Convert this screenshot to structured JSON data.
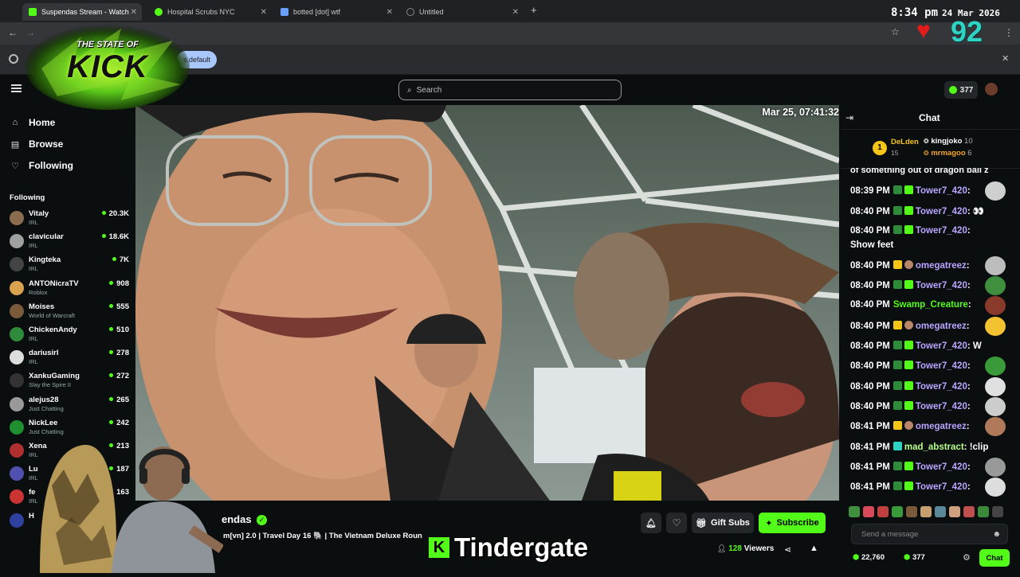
{
  "browser": {
    "tabs": [
      {
        "label": "Suspendas Stream - Watch",
        "active": true,
        "color": "#53fc18"
      },
      {
        "label": "Hospital Scrubs NYC",
        "active": false,
        "color": "#53fc18"
      },
      {
        "label": "botted [dot] wtf",
        "active": false,
        "color": "#6aa0ff"
      },
      {
        "label": "Untitled",
        "active": false,
        "color": "#888888"
      }
    ],
    "info_text": "s.default"
  },
  "overlay": {
    "clock": "8:34 pm",
    "date": "24 Mar 2026",
    "heart_count": "92",
    "logo_line1": "THE STATE OF",
    "logo_line2": "KICK",
    "bottom_banner": "Tindergate"
  },
  "header": {
    "search_placeholder": "Search",
    "points": "377"
  },
  "sidebar": {
    "nav": [
      {
        "label": "Home",
        "icon": "home-icon"
      },
      {
        "label": "Browse",
        "icon": "browse-icon"
      },
      {
        "label": "Following",
        "icon": "heart-icon"
      }
    ],
    "following_title": "Following",
    "following": [
      {
        "name": "Vitaly",
        "category": "IRL",
        "viewers": "20.3K",
        "color": "#8a6d4e"
      },
      {
        "name": "clavicular",
        "category": "IRL",
        "viewers": "18.6K",
        "color": "#a0a0a0"
      },
      {
        "name": "Kingteka",
        "category": "IRL",
        "viewers": "7K",
        "color": "#444444"
      },
      {
        "name": "ANTONicraTV",
        "category": "Roblox",
        "viewers": "908",
        "color": "#d9a24e"
      },
      {
        "name": "Moises",
        "category": "World of Warcraft",
        "viewers": "555",
        "color": "#7a5a3a"
      },
      {
        "name": "ChickenAndy",
        "category": "IRL",
        "viewers": "510",
        "color": "#2e8b3a"
      },
      {
        "name": "dariusirl",
        "category": "IRL",
        "viewers": "278",
        "color": "#dddddd"
      },
      {
        "name": "XankuGaming",
        "category": "Slay the Spire II",
        "viewers": "272",
        "color": "#333333"
      },
      {
        "name": "alejus28",
        "category": "Just Chatting",
        "viewers": "265",
        "color": "#999999"
      },
      {
        "name": "NickLee",
        "category": "Just Chatting",
        "viewers": "242",
        "color": "#1f8f2f"
      },
      {
        "name": "Xena",
        "category": "IRL",
        "viewers": "213",
        "color": "#b03030"
      },
      {
        "name": "Lu",
        "category": "IRL",
        "viewers": "187",
        "color": "#5050b0"
      },
      {
        "name": "fe",
        "category": "IRL",
        "viewers": "163",
        "color": "#cc3333"
      },
      {
        "name": "H",
        "category": "",
        "viewers": "",
        "color": "#3040a0"
      }
    ]
  },
  "video": {
    "timestamp": "Mar 25, 07:41:32"
  },
  "stream": {
    "channel": "endas",
    "title": "m[vn] 2.0 | Travel Day 16 🐘 | The Vietnam Deluxe Roun",
    "gift_subs": "Gift Subs",
    "subscribe": "Subscribe",
    "viewers": "128",
    "viewers_label": "Viewers"
  },
  "chat": {
    "title": "Chat",
    "leaderboard": [
      {
        "rank": "1",
        "name": "DeLden",
        "count": "15"
      },
      {
        "name": "kingjoko",
        "count": "10"
      },
      {
        "name": "mrmagoo",
        "count": "6"
      }
    ],
    "partial_line": "of something out of dragon ball z",
    "messages": [
      {
        "time": "08:39 PM",
        "user": "Tower7_420",
        "text": "",
        "emote": "#cfcfcf"
      },
      {
        "time": "08:40 PM",
        "user": "Tower7_420",
        "text": "👀",
        "emote": ""
      },
      {
        "time": "08:40 PM",
        "user": "Tower7_420",
        "text": "",
        "emote": ""
      },
      {
        "time": "08:40 PM",
        "user": "omegatreez",
        "text": "",
        "emote": "#bdbdbd"
      },
      {
        "time": "08:40 PM",
        "user": "Tower7_420",
        "text": "",
        "emote": "#3f8f3f"
      },
      {
        "time": "08:40 PM",
        "user": "Swamp_Creature",
        "text": "",
        "emote": "#8a3a2a"
      },
      {
        "time": "08:40 PM",
        "user": "omegatreez",
        "text": "",
        "emote": "#f2c230"
      },
      {
        "time": "08:40 PM",
        "user": "Tower7_420",
        "text": "W",
        "emote": ""
      },
      {
        "time": "08:40 PM",
        "user": "Tower7_420",
        "text": "",
        "emote": "#3a9a3a"
      },
      {
        "time": "08:40 PM",
        "user": "Tower7_420",
        "text": "",
        "emote": "#e0e0e0"
      },
      {
        "time": "08:40 PM",
        "user": "Tower7_420",
        "text": "",
        "emote": "#cccccc"
      },
      {
        "time": "08:41 PM",
        "user": "omegatreez",
        "text": "",
        "emote": "#b07a5a"
      },
      {
        "time": "08:41 PM",
        "user": "mad_abstract",
        "text": "!clip",
        "emote": ""
      },
      {
        "time": "08:41 PM",
        "user": "Tower7_420",
        "text": "",
        "emote": "#999999"
      },
      {
        "time": "08:41 PM",
        "user": "Tower7_420",
        "text": "",
        "emote": "#dddddd"
      }
    ],
    "show_feet": "Show feet",
    "send_placeholder": "Send a message",
    "stat_points": "22,760",
    "stat_other": "377",
    "chat_button": "Chat"
  }
}
